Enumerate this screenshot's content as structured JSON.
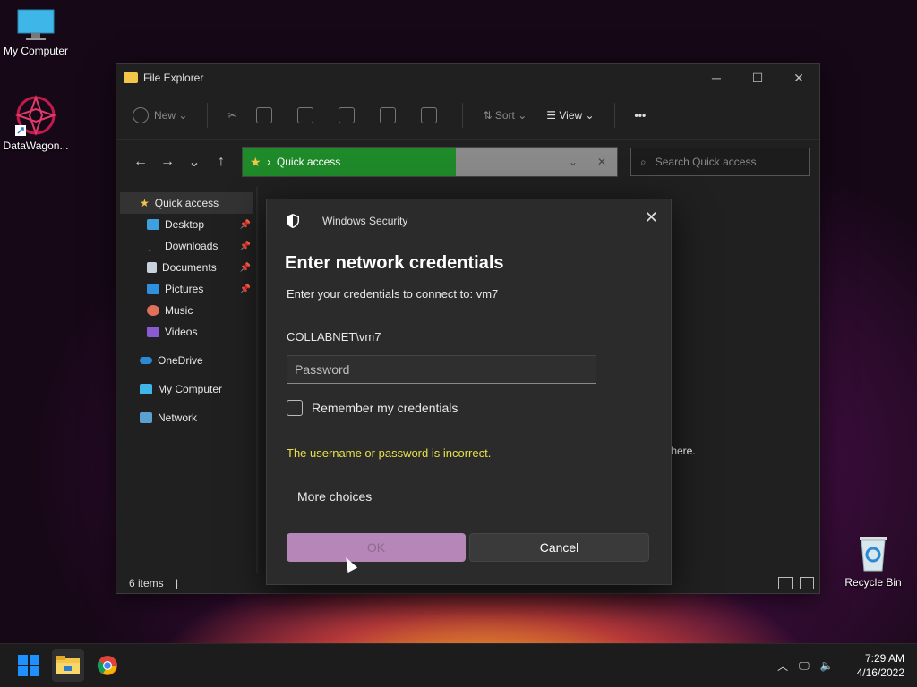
{
  "desktop": {
    "icons": [
      {
        "label": "My Computer"
      },
      {
        "label": "DataWagon..."
      },
      {
        "label": "Recycle Bin"
      }
    ]
  },
  "explorer": {
    "title": "File Explorer",
    "toolbar": {
      "new_label": "New",
      "sort_label": "Sort",
      "view_label": "View",
      "more_label": "•••"
    },
    "address": {
      "crumb": "Quick access"
    },
    "search": {
      "placeholder": "Search Quick access"
    },
    "nav": [
      {
        "label": "Quick access"
      },
      {
        "label": "Desktop"
      },
      {
        "label": "Downloads"
      },
      {
        "label": "Documents"
      },
      {
        "label": "Pictures"
      },
      {
        "label": "Music"
      },
      {
        "label": "Videos"
      },
      {
        "label": "OneDrive"
      },
      {
        "label": "My Computer"
      },
      {
        "label": "Network"
      }
    ],
    "content_hint": "s here.",
    "status": {
      "items": "6 items"
    }
  },
  "dialog": {
    "app": "Windows Security",
    "title": "Enter network credentials",
    "subtitle": "Enter your credentials to connect to: vm7",
    "username": "COLLABNET\\vm7",
    "password_placeholder": "Password",
    "remember_label": "Remember my credentials",
    "error": "The username or password is incorrect.",
    "more_choices": "More choices",
    "ok_label": "OK",
    "cancel_label": "Cancel"
  },
  "taskbar": {
    "time": "7:29 AM",
    "date": "4/16/2022"
  },
  "colors": {
    "accent_green": "#1f8a2a",
    "error_yellow": "#e7e04a",
    "ok_button": "#b786b8"
  }
}
